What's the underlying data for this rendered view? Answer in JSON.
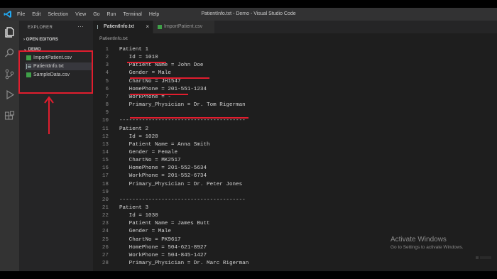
{
  "titlebar": {
    "menu": [
      "File",
      "Edit",
      "Selection",
      "View",
      "Go",
      "Run",
      "Terminal",
      "Help"
    ],
    "window_title": "PatientInfo.txt - Demo - Visual Studio Code"
  },
  "activity_bar": [
    "files-icon",
    "search-icon",
    "source-control-icon",
    "run-debug-icon",
    "extensions-icon"
  ],
  "sidebar": {
    "header": "EXPLORER",
    "more_label": "···",
    "open_editors_label": "OPEN EDITORS",
    "folder_label": "DEMO",
    "files": [
      {
        "name": "ImportPatient.csv",
        "type": "csv"
      },
      {
        "name": "PatientInfo.txt",
        "type": "txt"
      },
      {
        "name": "SampleData.csv",
        "type": "csv"
      }
    ]
  },
  "tabs": [
    {
      "label": "PatientInfo.txt",
      "close": "×"
    },
    {
      "label": "ImportPatient.csv"
    }
  ],
  "breadcrumb": "PatientInfo.txt",
  "editor": {
    "lines": [
      {
        "n": "1",
        "t": "Patient 1"
      },
      {
        "n": "2",
        "t": "   Id = 1010"
      },
      {
        "n": "3",
        "t": "   Patient Name = John Doe"
      },
      {
        "n": "4",
        "t": "   Gender = Male"
      },
      {
        "n": "5",
        "t": "   ChartNo = JH1547"
      },
      {
        "n": "6",
        "t": "   HomePhone = 201-551-1234"
      },
      {
        "n": "7",
        "t": "   WorkPhone = -"
      },
      {
        "n": "8",
        "t": "   Primary_Physician = Dr. Tom Rigerman"
      },
      {
        "n": "9",
        "t": ""
      },
      {
        "n": "10",
        "t": "---------------------------------------"
      },
      {
        "n": "11",
        "t": "Patient 2"
      },
      {
        "n": "12",
        "t": "   Id = 1020"
      },
      {
        "n": "13",
        "t": "   Patient Name = Anna Smith"
      },
      {
        "n": "14",
        "t": "   Gender = Female"
      },
      {
        "n": "15",
        "t": "   ChartNo = MK2517"
      },
      {
        "n": "16",
        "t": "   HomePhone = 201-552-5634"
      },
      {
        "n": "17",
        "t": "   WorkPhone = 201-552-6734"
      },
      {
        "n": "18",
        "t": "   Primary_Physician = Dr. Peter Jones"
      },
      {
        "n": "19",
        "t": ""
      },
      {
        "n": "20",
        "t": "---------------------------------------"
      },
      {
        "n": "21",
        "t": "Patient 3"
      },
      {
        "n": "22",
        "t": "   Id = 1030"
      },
      {
        "n": "23",
        "t": "   Patient Name = James Butt"
      },
      {
        "n": "24",
        "t": "   Gender = Male"
      },
      {
        "n": "25",
        "t": "   ChartNo = PK9617"
      },
      {
        "n": "26",
        "t": "   HomePhone = 504-621-8927"
      },
      {
        "n": "27",
        "t": "   WorkPhone = 504-845-1427"
      },
      {
        "n": "28",
        "t": "   Primary_Physician = Dr. Marc Rigerman"
      }
    ]
  },
  "watermark": {
    "title": "Activate Windows",
    "subtitle": "Go to Settings to activate Windows."
  },
  "colors": {
    "annotation_red": "#e11d2e",
    "csv_icon": "#3fa048",
    "vscode_blue": "#23a9f2"
  }
}
